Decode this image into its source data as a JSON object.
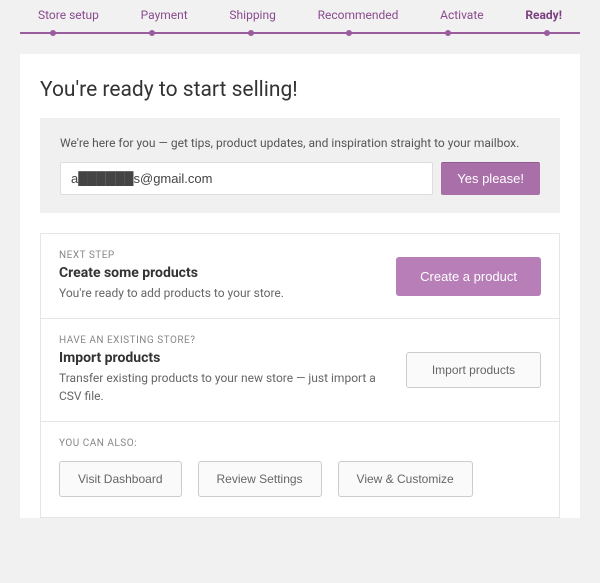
{
  "stepper": {
    "items": [
      {
        "label": "Store setup"
      },
      {
        "label": "Payment"
      },
      {
        "label": "Shipping"
      },
      {
        "label": "Recommended"
      },
      {
        "label": "Activate"
      },
      {
        "label": "Ready!"
      }
    ]
  },
  "main": {
    "title": "You're ready to start selling!",
    "subscribe": {
      "text": "We're here for you — get tips, product updates, and inspiration straight to your mailbox.",
      "email_value": "a██████s@gmail.com",
      "cta": "Yes please!"
    },
    "actions": [
      {
        "eyebrow": "NEXT STEP",
        "title": "Create some products",
        "desc": "You're ready to add products to your store.",
        "button": "Create a product",
        "button_style": "primary"
      },
      {
        "eyebrow": "HAVE AN EXISTING STORE?",
        "title": "Import products",
        "desc": "Transfer existing products to your new store — just import a CSV file.",
        "button": "Import products",
        "button_style": "secondary"
      }
    ],
    "also": {
      "eyebrow": "YOU CAN ALSO:",
      "buttons": [
        "Visit Dashboard",
        "Review Settings",
        "View & Customize"
      ]
    }
  }
}
